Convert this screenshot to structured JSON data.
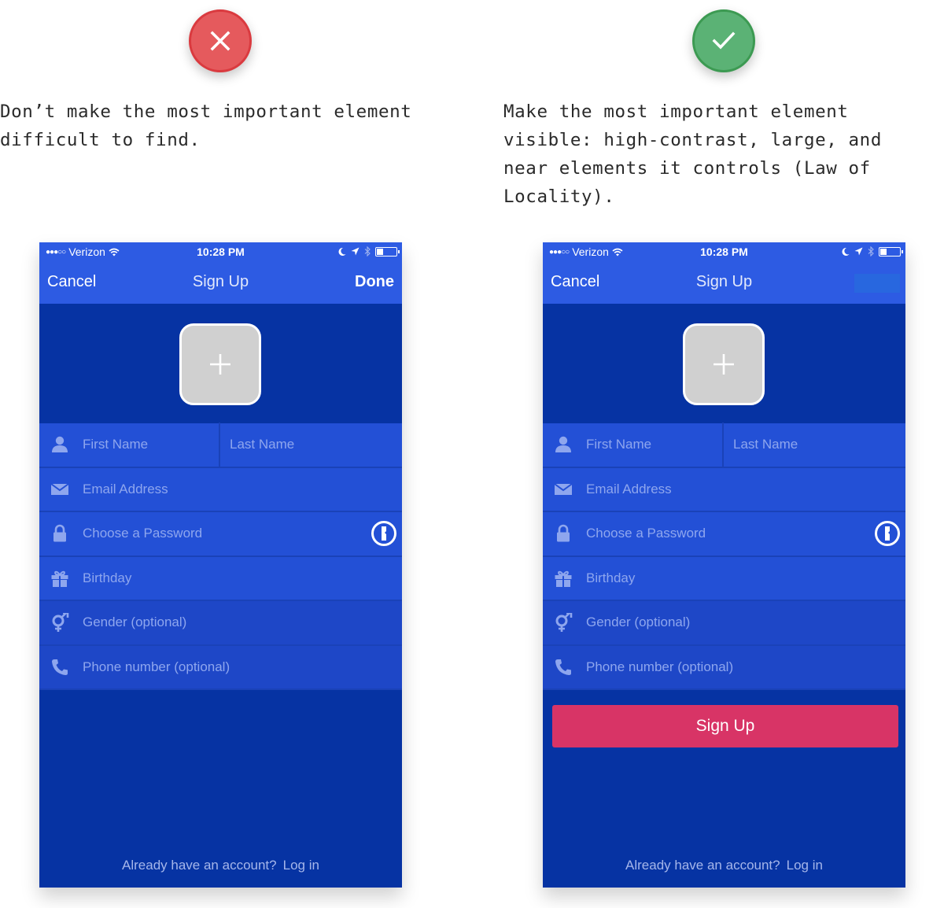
{
  "comparison": {
    "bad": {
      "badge_icon": "x-icon",
      "badge_color": "#e55a5d",
      "caption": "Don’t make the most important element\ndifficult to find."
    },
    "good": {
      "badge_icon": "checkmark-icon",
      "badge_color": "#5bb275",
      "caption": "Make the most important element\nvisible: high-contrast, large, and\nnear elements it controls (Law of\nLocality)."
    }
  },
  "phone": {
    "status_bar": {
      "carrier": "Verizon",
      "signal_dots": "●●●○○",
      "time": "10:28 PM"
    },
    "nav": {
      "cancel": "Cancel",
      "title": "Sign Up",
      "done": "Done"
    },
    "avatar": {
      "add_icon": "plus-icon"
    },
    "form": {
      "first_name": "First Name",
      "last_name": "Last Name",
      "email": "Email Address",
      "password": "Choose a Password",
      "birthday": "Birthday",
      "gender": "Gender (optional)",
      "phone": "Phone number (optional)"
    },
    "signup_button": "Sign Up",
    "footer": {
      "question": "Already have an account?",
      "login": "Log in"
    }
  },
  "colors": {
    "nav_bg": "#2d5be3",
    "body_bg": "#0633a3",
    "field_bg": "#2350d6",
    "cta": "#d83466"
  }
}
